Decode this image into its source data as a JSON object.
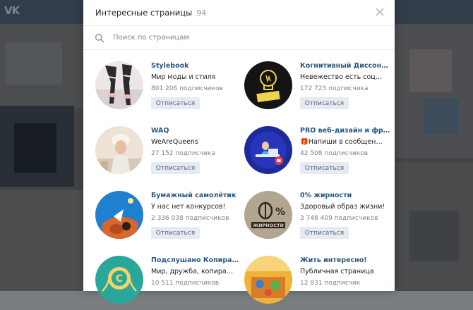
{
  "background": {
    "logo": "VK"
  },
  "modal": {
    "title": "Интересные страницы",
    "count": "94",
    "search_placeholder": "Поиск по страницам"
  },
  "pages": [
    {
      "name": "Stylebook",
      "status": "Мир моды и стиля",
      "subscribers": "801 206 подписчиков",
      "button": "Отписаться"
    },
    {
      "name": "Когнитивный Диссонанс",
      "status": "Невежество есть социальн…",
      "subscribers": "172 723 подписчика",
      "button": "Отписаться"
    },
    {
      "name": "WAQ",
      "status": "WeAreQueens",
      "subscribers": "27 152 подписчика",
      "button": "Отписаться"
    },
    {
      "name": "PRO веб-дизайн и фриланс…",
      "status": "🎁Напиши в сообщения со…",
      "subscribers": "42 508 подписчиков",
      "button": "Отписаться"
    },
    {
      "name": "Бумажный самолётик",
      "status": "У нас нет конкурсов!",
      "subscribers": "2 336 038 подписчиков",
      "button": "Отписаться"
    },
    {
      "name": "0% жирности",
      "status": "Здоровый образ жизни!",
      "subscribers": "3 748 409 подписчиков",
      "button": "Отписаться"
    },
    {
      "name": "Подслушано Копирайтинг",
      "status": "Мир, дружба, копирайтинг!",
      "subscribers": "10 511 подписчиков",
      "button": "Отписаться"
    },
    {
      "name": "Жить интересно!",
      "status": "Публичная страница",
      "subscribers": "12 831 подписчик",
      "button": "Отписаться"
    }
  ],
  "avatar_labels": {
    "cognitive": "Когнитивный Диссонанс",
    "zero": "ЖИРНОСТИ"
  }
}
